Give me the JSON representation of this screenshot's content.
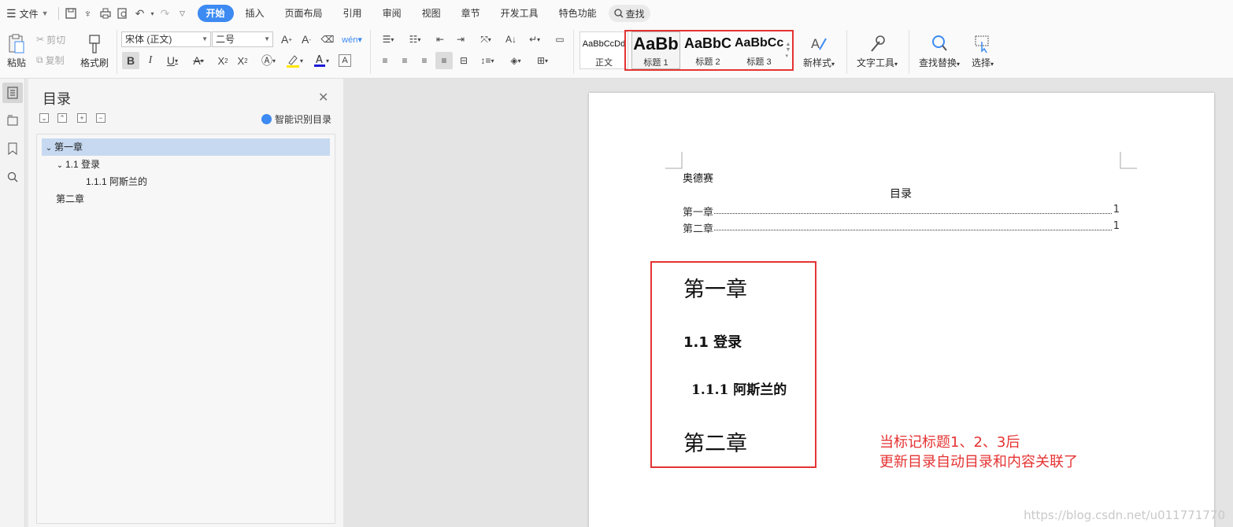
{
  "topbar": {
    "file_label": "文件",
    "tabs": [
      "开始",
      "插入",
      "页面布局",
      "引用",
      "审阅",
      "视图",
      "章节",
      "开发工具",
      "特色功能"
    ],
    "search_label": "查找"
  },
  "ribbon": {
    "paste_label": "粘贴",
    "cut_label": "剪切",
    "copy_label": "复制",
    "format_painter_label": "格式刷",
    "font_name": "宋体 (正文)",
    "font_size": "二号",
    "styles": [
      {
        "sample": "AaBbCcDd",
        "name": "正文"
      },
      {
        "sample": "AaBb",
        "name": "标题 1"
      },
      {
        "sample": "AaBbC",
        "name": "标题 2"
      },
      {
        "sample": "AaBbCc",
        "name": "标题 3"
      }
    ],
    "new_style_label": "新样式",
    "text_tools_label": "文字工具",
    "find_replace_label": "查找替换",
    "select_label": "选择"
  },
  "nav": {
    "title": "目录",
    "smart_label": "智能识别目录",
    "items": [
      "第一章",
      "1.1 登录",
      "1.1.1 阿斯兰的",
      "第二章"
    ]
  },
  "doc": {
    "author_line": "奥德赛",
    "toc_title": "目录",
    "toc": [
      {
        "label": "第一章",
        "page": "1"
      },
      {
        "label": "第二章",
        "page": "1"
      }
    ],
    "h1a": "第一章",
    "h2": "1.1 登录",
    "h3": "1.1.1 阿斯兰的",
    "h1b": "第二章",
    "annotation_line1": "当标记标题1、2、3后",
    "annotation_line2": "更新目录自动目录和内容关联了",
    "watermark": "https://blog.csdn.net/u011771770"
  },
  "colors": {
    "accent": "#3c8af2",
    "highlight_frame": "#e53333",
    "nav_selected": "#c6d9f1"
  }
}
